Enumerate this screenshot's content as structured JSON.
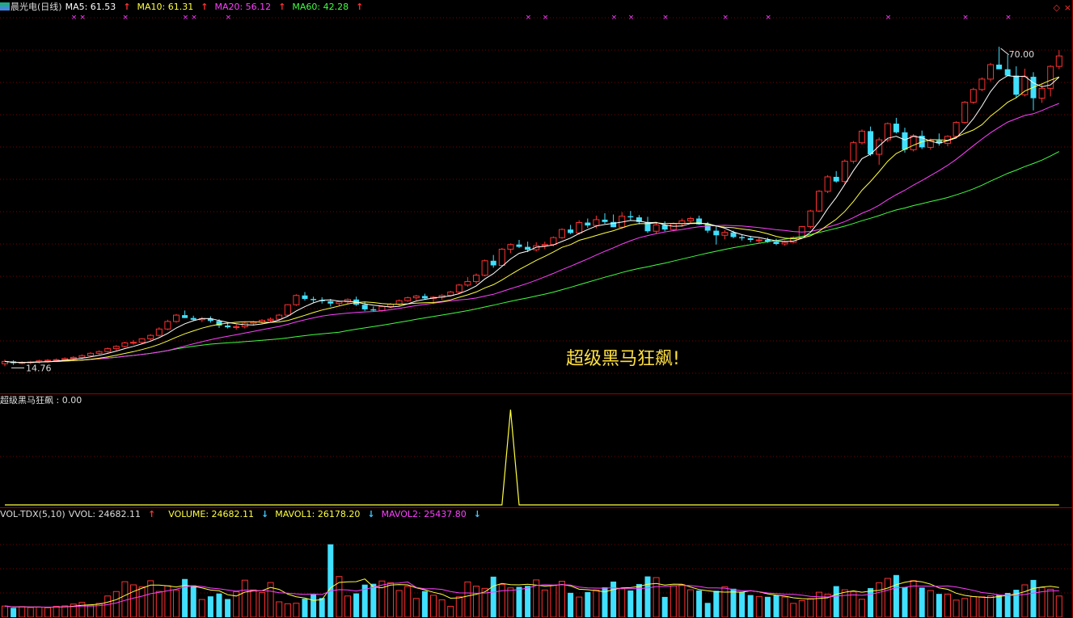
{
  "main": {
    "title": "晨光电(日线)",
    "ma5_label": "MA5: 61.53",
    "ma10_label": "MA10: 61.31",
    "ma20_label": "MA20: 56.12",
    "ma60_label": "MA60: 42.28",
    "high_label": "70.00",
    "low_label": "14.76",
    "hint_text": "超级黑马狂飙!",
    "colors": {
      "ma5": "#ffffff",
      "ma10": "#ffff40",
      "ma20": "#ff40ff",
      "ma60": "#40ff40",
      "up": "#ff3030",
      "down": "#40e0ff"
    }
  },
  "signal": {
    "label": "超级黑马狂飙 : 0.00"
  },
  "volume": {
    "tdx_label": "VOL-TDX(5,10)",
    "vvol_label": "VVOL: 24682.11",
    "volume_label": "VOLUME: 24682.11",
    "mavol1_label": "MAVOL1: 26178.20",
    "mavol2_label": "MAVOL2: 25437.80"
  },
  "chart_data": [
    {
      "type": "candlestick",
      "title": "晨光电(日线)",
      "ylim": [
        13,
        75
      ],
      "max_price": 70.0,
      "min_price": 14.76,
      "ohlc": [
        [
          15.2,
          15.9,
          14.76,
          15.6
        ],
        [
          15.6,
          15.8,
          15.0,
          15.3
        ],
        [
          15.3,
          15.6,
          15.1,
          15.4
        ],
        [
          15.4,
          15.7,
          15.1,
          15.5
        ],
        [
          15.5,
          15.9,
          15.2,
          15.7
        ],
        [
          15.7,
          16.0,
          15.4,
          15.8
        ],
        [
          15.8,
          16.1,
          15.5,
          15.9
        ],
        [
          15.9,
          16.3,
          15.6,
          16.1
        ],
        [
          16.1,
          16.5,
          15.8,
          16.3
        ],
        [
          16.3,
          16.8,
          16.0,
          16.6
        ],
        [
          16.6,
          17.2,
          16.4,
          17.0
        ],
        [
          17.0,
          17.5,
          16.8,
          17.3
        ],
        [
          17.3,
          18.0,
          17.1,
          17.8
        ],
        [
          17.8,
          18.4,
          17.5,
          18.2
        ],
        [
          18.2,
          19.0,
          18.0,
          18.8
        ],
        [
          18.8,
          19.3,
          18.5,
          18.9
        ],
        [
          18.9,
          19.6,
          18.7,
          19.5
        ],
        [
          19.5,
          20.3,
          19.2,
          20.1
        ],
        [
          20.1,
          21.5,
          19.9,
          21.2
        ],
        [
          21.2,
          22.8,
          21.0,
          22.5
        ],
        [
          22.5,
          23.8,
          22.3,
          23.6
        ],
        [
          23.6,
          24.4,
          23.1,
          23.1
        ],
        [
          23.1,
          23.5,
          22.6,
          22.8
        ],
        [
          22.8,
          23.3,
          22.4,
          23.0
        ],
        [
          23.0,
          23.4,
          22.3,
          22.6
        ],
        [
          22.6,
          22.9,
          21.4,
          21.8
        ],
        [
          21.8,
          22.3,
          21.3,
          21.5
        ],
        [
          21.5,
          22.0,
          21.1,
          21.6
        ],
        [
          21.6,
          22.4,
          21.3,
          22.2
        ],
        [
          22.2,
          22.6,
          21.8,
          22.4
        ],
        [
          22.4,
          22.9,
          22.1,
          22.7
        ],
        [
          22.7,
          23.2,
          22.3,
          22.9
        ],
        [
          22.9,
          23.8,
          22.6,
          23.6
        ],
        [
          23.6,
          25.5,
          23.4,
          25.4
        ],
        [
          25.4,
          27.2,
          25.2,
          27.0
        ],
        [
          27.0,
          27.6,
          26.1,
          26.4
        ],
        [
          26.4,
          26.8,
          25.8,
          26.2
        ],
        [
          26.2,
          26.7,
          25.6,
          26.0
        ],
        [
          26.0,
          26.4,
          25.1,
          25.6
        ],
        [
          25.6,
          26.1,
          25.2,
          25.9
        ],
        [
          25.9,
          26.5,
          25.5,
          26.3
        ],
        [
          26.3,
          26.8,
          25.2,
          25.4
        ],
        [
          25.4,
          25.8,
          24.3,
          24.6
        ],
        [
          24.6,
          25.1,
          24.2,
          24.4
        ],
        [
          24.4,
          25.3,
          24.2,
          25.1
        ],
        [
          25.1,
          25.7,
          24.8,
          25.5
        ],
        [
          25.5,
          26.3,
          25.2,
          26.1
        ],
        [
          26.1,
          26.8,
          25.9,
          26.6
        ],
        [
          26.6,
          27.1,
          26.2,
          26.9
        ],
        [
          26.9,
          27.3,
          26.3,
          26.5
        ],
        [
          26.5,
          26.9,
          25.5,
          26.7
        ],
        [
          26.7,
          27.2,
          26.2,
          27.0
        ],
        [
          27.0,
          27.8,
          26.8,
          27.6
        ],
        [
          27.6,
          29.0,
          27.3,
          28.8
        ],
        [
          28.8,
          30.2,
          28.5,
          29.4
        ],
        [
          29.4,
          30.8,
          29.0,
          30.5
        ],
        [
          30.5,
          33.2,
          30.3,
          33.0
        ],
        [
          33.0,
          34.0,
          31.8,
          32.2
        ],
        [
          32.2,
          35.2,
          32.0,
          35.0
        ],
        [
          35.0,
          36.0,
          34.3,
          35.8
        ],
        [
          35.8,
          36.6,
          35.2,
          35.4
        ],
        [
          35.4,
          36.3,
          34.5,
          34.9
        ],
        [
          34.9,
          36.2,
          34.6,
          35.6
        ],
        [
          35.6,
          36.3,
          35.0,
          35.8
        ],
        [
          35.8,
          37.2,
          35.5,
          37.0
        ],
        [
          37.0,
          38.6,
          36.8,
          38.4
        ],
        [
          38.4,
          39.2,
          37.6,
          37.8
        ],
        [
          37.8,
          40.0,
          37.5,
          39.6
        ],
        [
          39.6,
          40.3,
          38.7,
          39.1
        ],
        [
          39.1,
          40.8,
          38.6,
          40.1
        ],
        [
          40.1,
          41.2,
          39.4,
          39.7
        ],
        [
          39.7,
          41.0,
          38.8,
          38.8
        ],
        [
          38.8,
          41.4,
          38.5,
          40.7
        ],
        [
          40.7,
          41.6,
          40.0,
          40.5
        ],
        [
          40.5,
          40.9,
          39.3,
          39.7
        ],
        [
          39.7,
          40.6,
          37.8,
          38.1
        ],
        [
          38.1,
          39.5,
          37.7,
          39.2
        ],
        [
          39.2,
          39.8,
          38.1,
          38.4
        ],
        [
          38.4,
          39.6,
          38.1,
          39.4
        ],
        [
          39.4,
          40.3,
          38.9,
          39.9
        ],
        [
          39.9,
          40.6,
          39.4,
          40.3
        ],
        [
          40.3,
          40.8,
          39.2,
          39.3
        ],
        [
          39.3,
          39.7,
          37.8,
          38.2
        ],
        [
          38.2,
          38.9,
          35.8,
          37.4
        ],
        [
          37.4,
          38.3,
          36.7,
          37.9
        ],
        [
          37.9,
          38.2,
          36.9,
          37.1
        ],
        [
          37.1,
          37.6,
          36.5,
          36.9
        ],
        [
          36.9,
          37.3,
          36.2,
          36.6
        ],
        [
          36.6,
          37.1,
          36.0,
          36.6
        ],
        [
          36.6,
          37.0,
          36.1,
          36.3
        ],
        [
          36.3,
          36.8,
          35.7,
          35.9
        ],
        [
          35.9,
          36.5,
          35.6,
          36.2
        ],
        [
          36.2,
          37.2,
          36.0,
          37.0
        ],
        [
          37.0,
          39.0,
          36.8,
          38.9
        ],
        [
          38.9,
          41.8,
          38.6,
          41.6
        ],
        [
          41.6,
          45.2,
          41.4,
          45.0
        ],
        [
          45.0,
          47.8,
          44.7,
          47.5
        ],
        [
          47.5,
          48.5,
          46.5,
          46.7
        ],
        [
          46.7,
          50.5,
          46.3,
          50.2
        ],
        [
          50.2,
          53.7,
          49.8,
          53.4
        ],
        [
          53.4,
          55.7,
          53.1,
          55.4
        ],
        [
          55.4,
          56.2,
          51.1,
          51.4
        ],
        [
          51.4,
          54.3,
          49.6,
          53.9
        ],
        [
          53.9,
          56.9,
          53.5,
          56.7
        ],
        [
          56.7,
          57.7,
          55.0,
          55.2
        ],
        [
          55.2,
          56.0,
          51.7,
          52.2
        ],
        [
          52.2,
          54.9,
          51.9,
          54.6
        ],
        [
          54.6,
          55.5,
          52.3,
          52.6
        ],
        [
          52.6,
          54.1,
          52.2,
          53.8
        ],
        [
          53.8,
          55.0,
          52.9,
          53.3
        ],
        [
          53.3,
          54.7,
          52.8,
          54.5
        ],
        [
          54.5,
          57.1,
          54.3,
          56.9
        ],
        [
          56.9,
          60.6,
          56.7,
          60.4
        ],
        [
          60.4,
          62.9,
          60.1,
          62.6
        ],
        [
          62.6,
          64.7,
          62.3,
          64.4
        ],
        [
          64.4,
          67.2,
          64.0,
          66.9
        ],
        [
          66.9,
          70.0,
          66.6,
          66.1
        ],
        [
          66.1,
          68.6,
          65.4,
          65.0
        ],
        [
          65.0,
          66.6,
          61.1,
          61.7
        ],
        [
          61.7,
          66.2,
          61.4,
          64.8
        ],
        [
          64.8,
          65.6,
          59.0,
          61.1
        ],
        [
          61.1,
          63.6,
          60.3,
          62.8
        ],
        [
          62.8,
          66.8,
          61.4,
          66.6
        ],
        [
          66.6,
          69.4,
          66.1,
          68.4
        ]
      ]
    },
    {
      "type": "line",
      "title": "超级黑马狂飙",
      "value": 0.0,
      "ylim": [
        0,
        1
      ],
      "series": [
        {
          "values_at_index": [
            [
              59,
              1
            ]
          ]
        }
      ]
    },
    {
      "type": "bar",
      "title": "VOL-TDX(5,10)",
      "ylim": [
        0,
        80000
      ],
      "values": [
        9500,
        8000,
        9000,
        8200,
        8600,
        8100,
        9300,
        9700,
        11200,
        12600,
        10300,
        11800,
        18100,
        21900,
        30300,
        27600,
        25900,
        31100,
        22000,
        26800,
        23200,
        32600,
        27200,
        15100,
        17800,
        20200,
        15500,
        21700,
        31600,
        23300,
        21000,
        29600,
        13100,
        11500,
        11900,
        15800,
        19300,
        16400,
        62200,
        34700,
        18100,
        20300,
        27800,
        28500,
        30900,
        29400,
        22800,
        26300,
        16000,
        22300,
        18700,
        14800,
        9300,
        17400,
        30100,
        26500,
        24600,
        34600,
        28000,
        25000,
        25900,
        26700,
        31800,
        23200,
        27300,
        30700,
        20800,
        17200,
        21400,
        23300,
        25500,
        30400,
        24300,
        22800,
        28300,
        34800,
        33800,
        17300,
        26900,
        27700,
        23400,
        22800,
        12200,
        22500,
        25900,
        24300,
        21500,
        18900,
        17700,
        17400,
        18700,
        17200,
        11800,
        14200,
        15800,
        21300,
        19700,
        26500,
        23400,
        21600,
        15300,
        24800,
        29400,
        33100,
        36000,
        25600,
        31200,
        25300,
        22800,
        19900,
        19700,
        14600,
        16000,
        17600,
        17400,
        18200,
        19100,
        20700,
        23400,
        27600,
        31800,
        25300,
        23900,
        18100,
        19600,
        21700
      ]
    }
  ]
}
